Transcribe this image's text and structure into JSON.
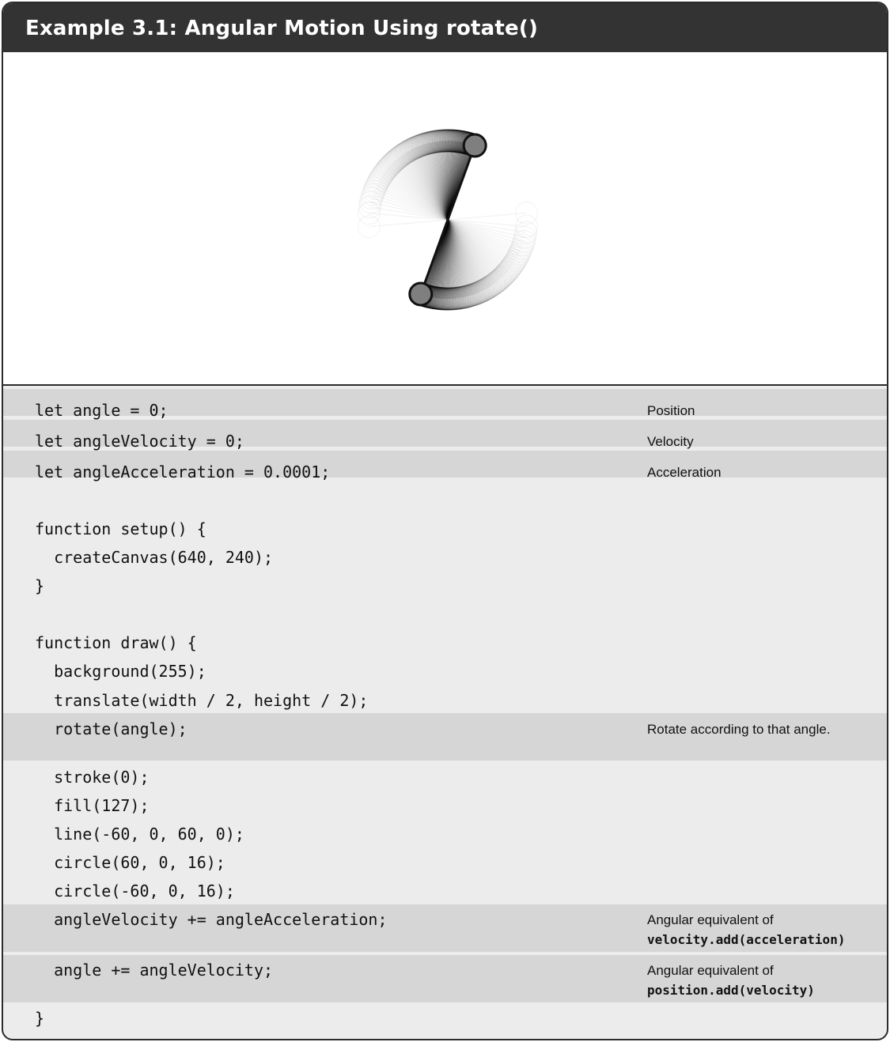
{
  "header": {
    "title": "Example 3.1: Angular Motion Using rotate()"
  },
  "code": {
    "lines": [
      "let angle = 0;",
      "let angleVelocity = 0;",
      "let angleAcceleration = 0.0001;",
      "function setup() {",
      "  createCanvas(640, 240);",
      "}",
      "function draw() {",
      "  background(255);",
      "  translate(width / 2, height / 2);",
      "  rotate(angle);",
      "  stroke(0);",
      "  fill(127);",
      "  line(-60, 0, 60, 0);",
      "  circle(60, 0, 16);",
      "  circle(-60, 0, 16);",
      "  angleVelocity += angleAcceleration;",
      "  angle += angleVelocity;",
      "}"
    ]
  },
  "annotations": {
    "position": "Position",
    "velocity": "Velocity",
    "acceleration": "Acceleration",
    "rotate": "Rotate according to that angle.",
    "velocity_add_prefix": "Angular equivalent of",
    "velocity_add_code": "velocity.add(acceleration)",
    "position_add_prefix": "Angular equivalent of",
    "position_add_code": "position.add(velocity)"
  },
  "colors": {
    "header_bg": "#333333",
    "band_bg": "#d6d6d6",
    "code_bg": "#ececec",
    "ball_fill": "#7f7f7f"
  }
}
